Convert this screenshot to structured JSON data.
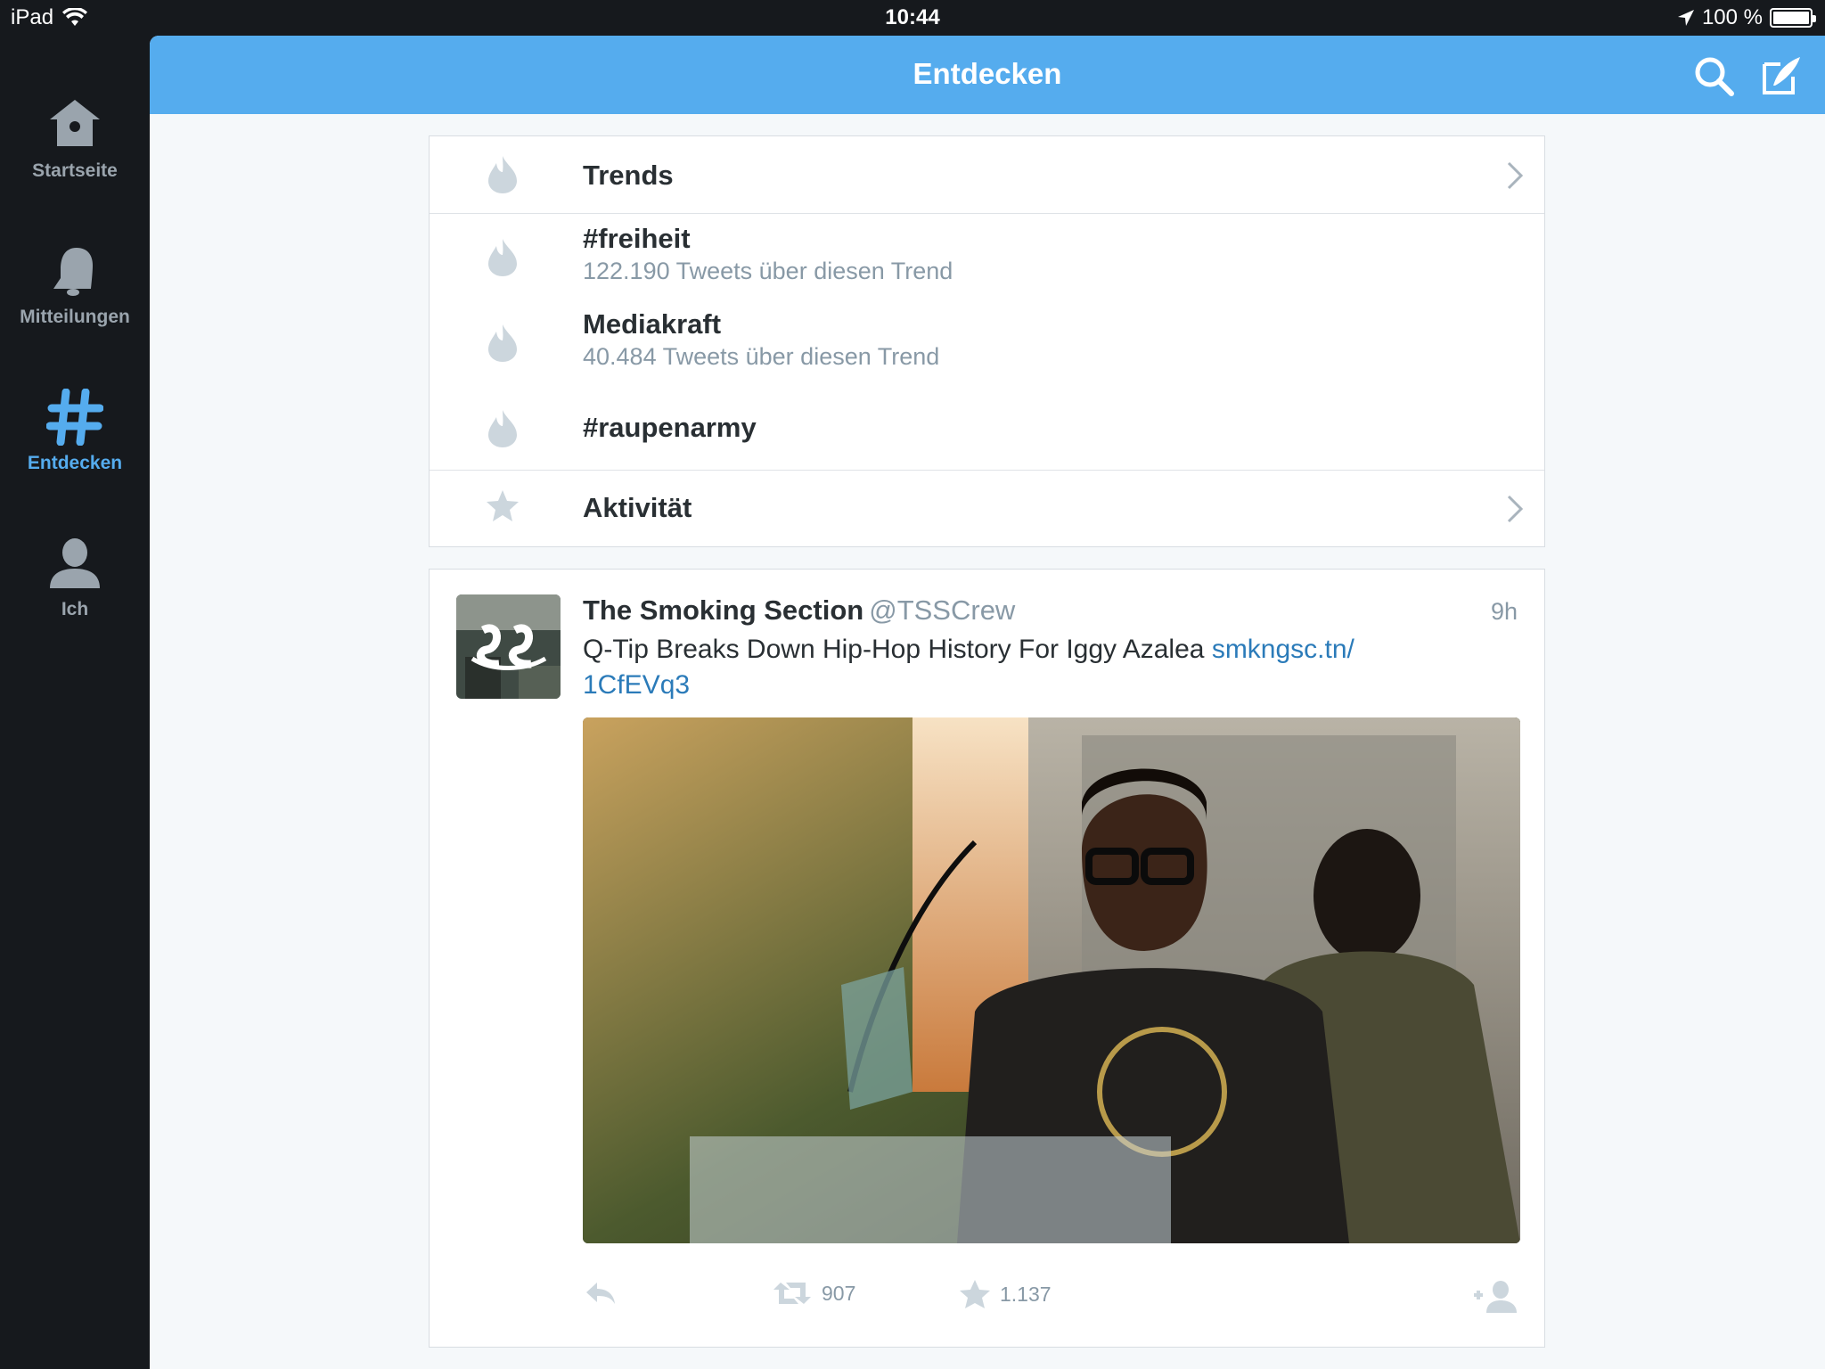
{
  "status_bar": {
    "device": "iPad",
    "time": "10:44",
    "battery_text": "100 %",
    "icons": [
      "wifi-icon",
      "location-arrow-icon",
      "battery-icon"
    ]
  },
  "sidebar": {
    "items": [
      {
        "label": "Startseite",
        "icon": "home-icon",
        "active": false
      },
      {
        "label": "Mitteilungen",
        "icon": "bell-icon",
        "active": false
      },
      {
        "label": "Entdecken",
        "icon": "hashtag-icon",
        "active": true
      },
      {
        "label": "Ich",
        "icon": "person-icon",
        "active": false
      }
    ]
  },
  "header": {
    "title": "Entdecken",
    "actions": [
      "search-icon",
      "compose-icon"
    ]
  },
  "discover": {
    "trends_header": "Trends",
    "trends": [
      {
        "tag": "#freiheit",
        "count_text": "122.190 Tweets über diesen Trend"
      },
      {
        "tag": "Mediakraft",
        "count_text": "40.484 Tweets über diesen Trend"
      },
      {
        "tag": "#raupenarmy",
        "count_text": ""
      }
    ],
    "activity_label": "Aktivität"
  },
  "tweet": {
    "name": "The Smoking Section",
    "handle": "@TSSCrew",
    "time": "9h",
    "text": "Q-Tip Breaks Down Hip-Hop History For Iggy Azalea",
    "link_text": "smkngsc.tn/",
    "link_text_2": "1CfEVq3",
    "retweets": "907",
    "favorites": "1.137"
  },
  "colors": {
    "accent": "#55acee",
    "sidebar_bg": "#16191d",
    "link": "#2b7bb9",
    "muted": "#8899a6"
  }
}
